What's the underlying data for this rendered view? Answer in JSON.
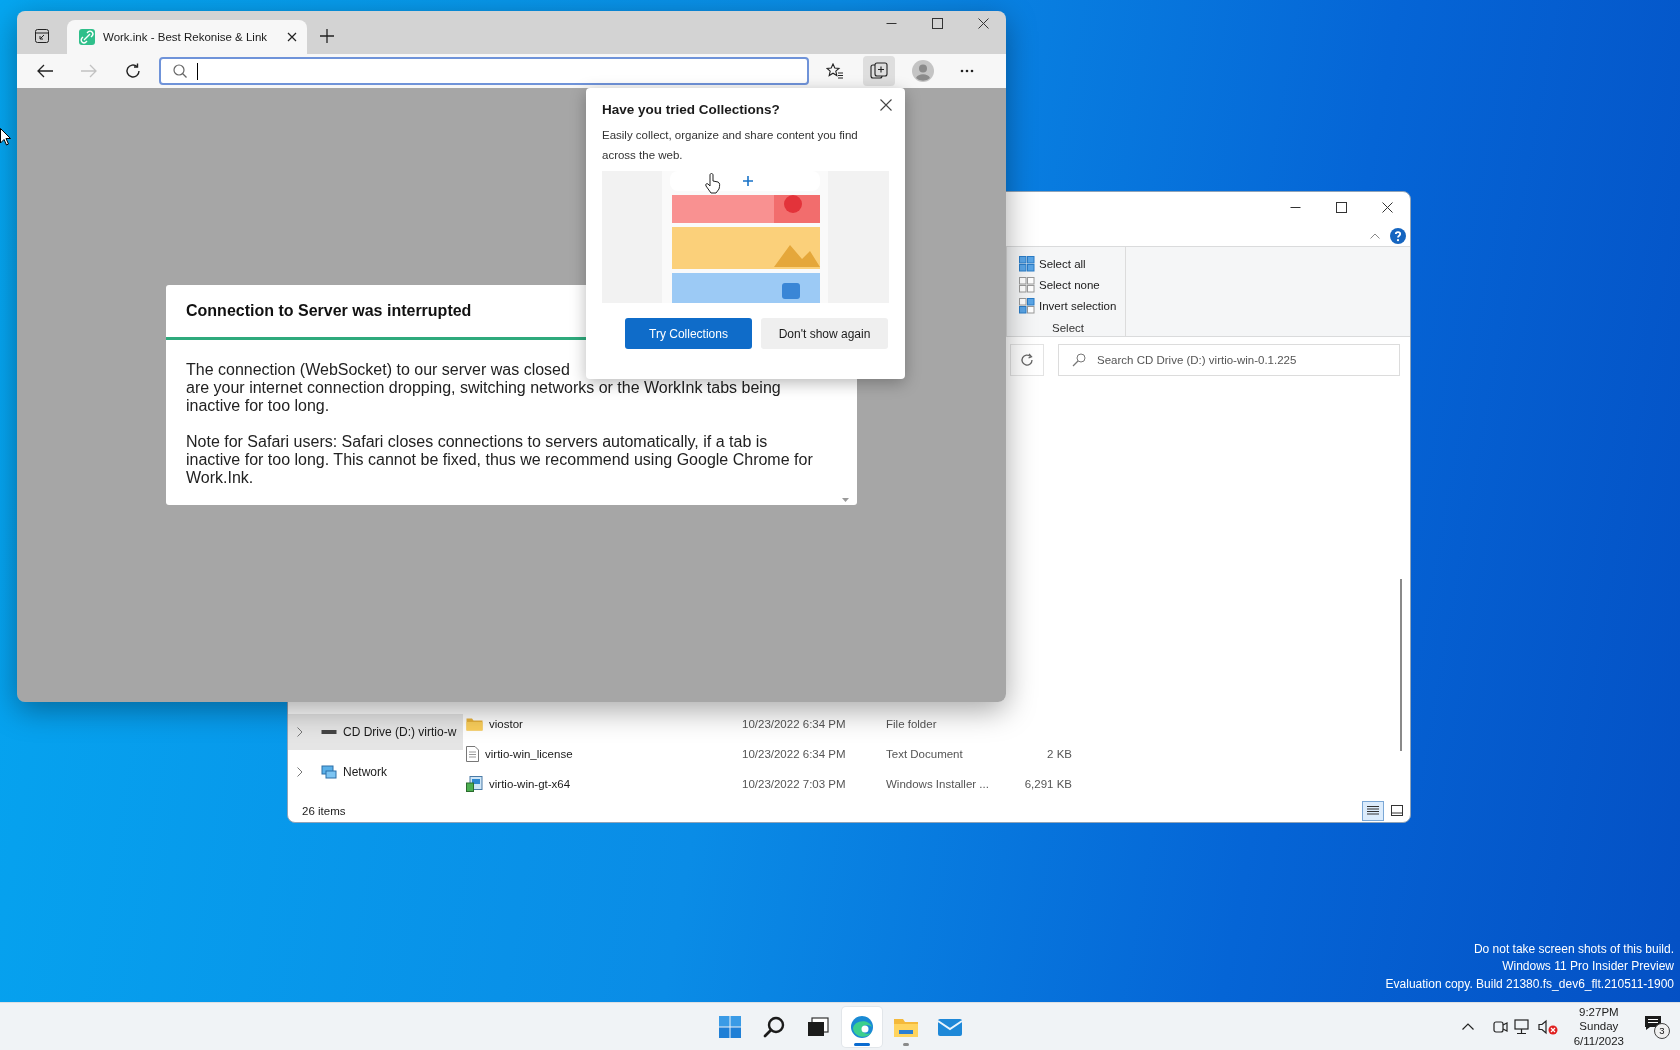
{
  "browser": {
    "tabs": [
      {
        "title": "Work.ink - Best Rekonise & Link",
        "selected": true
      }
    ],
    "dialog": {
      "title": "Connection to Server was interrupted",
      "paragraphs": [
        [
          "The connection (WebSocket) to our server was closed",
          "are your internet connection dropping, switching networks or the WorkInk tabs being",
          "inactive for too long."
        ],
        [
          "Note for Safari users: Safari closes connections to servers automatically, if a tab is",
          "inactive for too long. This cannot be fixed, thus we recommend using Google Chrome for",
          "Work.Ink."
        ]
      ]
    },
    "collections_popup": {
      "title": "Have you tried Collections?",
      "text": "Easily collect, organize and share content you find across the web.",
      "buttons": [
        {
          "label": "Try Collections",
          "kind": "primary"
        },
        {
          "label": "Don't show again",
          "kind": "secondary"
        }
      ]
    }
  },
  "explorer": {
    "ribbon_group": {
      "label": "Select",
      "items": [
        {
          "label": "Select all",
          "kind": "all"
        },
        {
          "label": "Select none",
          "kind": "none"
        },
        {
          "label": "Invert selection",
          "kind": "invert"
        }
      ]
    },
    "search": {
      "placeholder": "Search CD Drive (D:) virtio-win-0.1.225"
    },
    "nav_items": [
      {
        "label": "CD Drive (D:) virtio-w",
        "kind": "drive",
        "selected": true
      },
      {
        "label": "Network",
        "kind": "network",
        "selected": false
      }
    ],
    "files": [
      {
        "name": "viostor",
        "date": "10/23/2022 6:34 PM",
        "type": "File folder",
        "kind": "folder"
      },
      {
        "name": "virtio-win_license",
        "date": "10/23/2022 6:34 PM",
        "type": "Text Document",
        "size": "2 KB",
        "kind": "text"
      },
      {
        "name": "virtio-win-gt-x64",
        "date": "10/23/2022 7:03 PM",
        "type": "Windows Installer ...",
        "size": "6,291 KB",
        "kind": "installer"
      }
    ],
    "status": "26 items",
    "view_modes": [
      {
        "kind": "details",
        "selected": true
      },
      {
        "kind": "tiles",
        "selected": false
      }
    ]
  },
  "desktop_notice": [
    "Do not take screen shots of this build.",
    "Windows 11 Pro Insider Preview",
    "Evaluation copy. Build 21380.fs_dev6_flt.210511-1900"
  ],
  "taskbar": {
    "apps": [
      {
        "kind": "start",
        "running": false,
        "selected": false
      },
      {
        "kind": "search",
        "running": false,
        "selected": false
      },
      {
        "kind": "task_view",
        "running": false,
        "selected": false
      },
      {
        "kind": "edge",
        "running": true,
        "selected": true
      },
      {
        "kind": "explorer",
        "running": true,
        "selected": false
      },
      {
        "kind": "mail",
        "running": false,
        "selected": false
      }
    ],
    "clock": {
      "time": "9:27PM",
      "day": "Sunday",
      "date": "6/11/2023"
    },
    "notification_count": "3"
  }
}
